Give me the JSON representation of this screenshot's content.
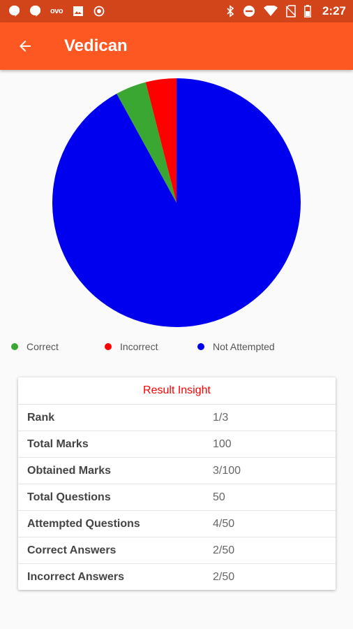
{
  "status_bar": {
    "time": "2:27",
    "ovo_label": "ovo",
    "left_icons": [
      "chat-bubble-icon",
      "chat-bubble-icon",
      "ovo-app-icon",
      "image-icon",
      "target-icon"
    ],
    "right_icons": [
      "bluetooth-icon",
      "do-not-disturb-icon",
      "wifi-icon",
      "no-sim-icon",
      "battery-icon"
    ]
  },
  "app_bar": {
    "title": "Vedican",
    "back_icon": "arrow-back-icon"
  },
  "chart_data": {
    "type": "pie",
    "slices": [
      {
        "label": "Correct",
        "value": 2,
        "color": "#39a732"
      },
      {
        "label": "Incorrect",
        "value": 2,
        "color": "#ff0000"
      },
      {
        "label": "Not Attempted",
        "value": 46,
        "color": "#0000ee"
      }
    ],
    "legend_position": "bottom"
  },
  "result": {
    "title": "Result Insight",
    "rows": [
      {
        "label": "Rank",
        "value": "1/3"
      },
      {
        "label": "Total Marks",
        "value": "100"
      },
      {
        "label": "Obtained Marks",
        "value": "3/100"
      },
      {
        "label": "Total Questions",
        "value": "50"
      },
      {
        "label": "Attempted Questions",
        "value": "4/50"
      },
      {
        "label": "Correct Answers",
        "value": "2/50"
      },
      {
        "label": "Incorrect Answers",
        "value": "2/50"
      }
    ]
  },
  "colors": {
    "status_bar": "#d2451b",
    "app_bar": "#fd5722",
    "accent_text": "#ff0000"
  }
}
